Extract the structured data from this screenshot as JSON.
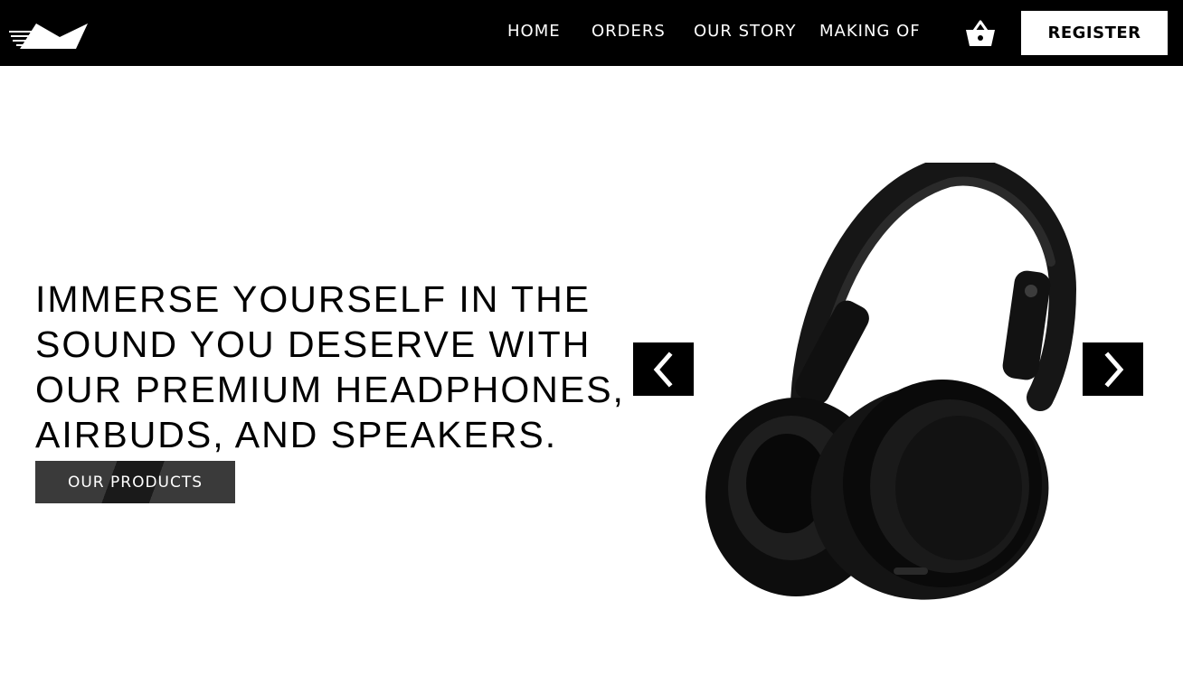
{
  "nav": {
    "logo_icon": "brand-logo-icon",
    "links": [
      {
        "label": "HOME"
      },
      {
        "label": "ORDERS"
      },
      {
        "label": "OUR STORY"
      },
      {
        "label": "MAKING OF"
      }
    ],
    "cart_icon": "basket-icon",
    "register_label": "REGISTER"
  },
  "hero": {
    "heading": "IMMERSE YOURSELF IN THE SOUND YOU DESERVE WITH OUR PREMIUM HEADPHONES, AIRBUDS, AND SPEAKERS.",
    "cta_label": "OUR PRODUCTS",
    "prev_icon": "chevron-left-icon",
    "next_icon": "chevron-right-icon",
    "product_image": "headphones-image"
  },
  "colors": {
    "nav_bg": "#000000",
    "page_bg": "#ffffff",
    "cta_bg": "#3a3a3a",
    "accent": "#ffffff"
  }
}
